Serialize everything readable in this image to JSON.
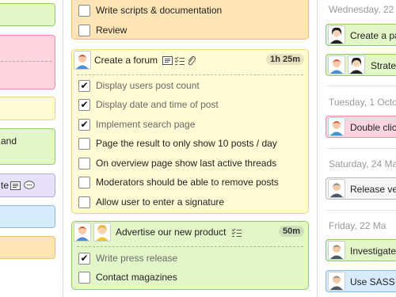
{
  "colors": {
    "green_bg": "#e2f6c8",
    "green_border": "#93cd62",
    "pink_bg": "#fdd5e0",
    "pink_border": "#f28aa6",
    "yellow_bg": "#fffbd4",
    "yellow_border": "#ecd77e",
    "orange_bg": "#ffe4b6",
    "orange_border": "#f1be6c",
    "lavender_bg": "#e7e2fa",
    "lavender_border": "#b5a8e3",
    "blue_bg": "#d8ebfd",
    "blue_border": "#88b9e9",
    "grey_bg": "#f7f7f7",
    "grey_border": "#b8b8b8"
  },
  "left": {
    "cards": [
      {
        "color": "green",
        "text": ""
      },
      {
        "color": "pink",
        "text": ""
      },
      {
        "color": "yellow",
        "text": ""
      },
      {
        "color": "green",
        "text": "and"
      },
      {
        "color": "lavender",
        "text": "te",
        "icons": [
          "note-icon",
          "comment-icon"
        ]
      },
      {
        "color": "blue",
        "text": ""
      },
      {
        "color": "orange",
        "text": ""
      }
    ]
  },
  "middle": {
    "top_card": {
      "color": "orange",
      "tasks": [
        {
          "label": "Write scripts & documentation",
          "done": false
        },
        {
          "label": "Review",
          "done": false
        }
      ]
    },
    "forum_card": {
      "color": "yellow",
      "title": "Create a forum",
      "duration": "1h 25m",
      "icons": [
        "note-icon",
        "checklist-icon",
        "attachment-icon"
      ],
      "tasks": [
        {
          "label": "Display users post count",
          "done": true
        },
        {
          "label": "Display date and time of post",
          "done": true
        },
        {
          "label": "Implement search page",
          "done": true
        },
        {
          "label": "Page the result to only show 10 posts / day",
          "done": false
        },
        {
          "label": "On overview page show last active threads",
          "done": false
        },
        {
          "label": "Moderators should be able to remove posts",
          "done": false
        },
        {
          "label": "Allow user to enter a signature",
          "done": false
        }
      ]
    },
    "product_card": {
      "color": "green",
      "title": "Advertise our new product",
      "duration": "50m",
      "icons": [
        "checklist-icon"
      ],
      "tasks": [
        {
          "label": "Write press release",
          "done": true
        },
        {
          "label": "Contact magazines",
          "done": false
        }
      ]
    }
  },
  "right": {
    "groups": [
      {
        "day": "Wednesday, 22",
        "cards": [
          {
            "title": "Create a pa",
            "color": "green",
            "avatars": [
              "woman-dark"
            ]
          },
          {
            "title": "Strateg",
            "color": "green",
            "avatars": [
              "man-red",
              "woman-dark"
            ]
          }
        ]
      },
      {
        "day": "Tuesday, 1 Octo",
        "cards": [
          {
            "title": "Double clic",
            "color": "pink",
            "avatars": [
              "man-red"
            ]
          }
        ]
      },
      {
        "day": "Saturday, 24 Ma",
        "cards": [
          {
            "title": "Release ve",
            "color": "grey",
            "avatars": [
              "man-grey"
            ]
          }
        ]
      },
      {
        "day": "Friday, 22 Ma",
        "cards": [
          {
            "title": "Investigate",
            "color": "green",
            "avatars": [
              "man-grey"
            ]
          },
          {
            "title": "Use SASS",
            "color": "blue",
            "avatars": [
              "man-grey"
            ]
          }
        ]
      }
    ]
  }
}
